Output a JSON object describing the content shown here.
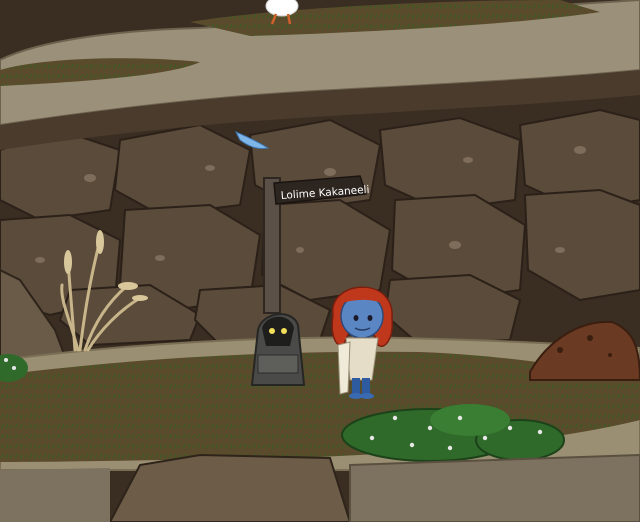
{
  "sign": {
    "label": "Lolime Kakaneeli"
  },
  "colors": {
    "cliff_dark": "#3a2d22",
    "rock": "#5a4a3b",
    "ledge": "#9a8f72",
    "ground_grass": "#4e4423",
    "bush": "#2f6a2a",
    "player_skin": "#5b86c4",
    "player_hair": "#c0381c"
  },
  "entities": {
    "player": "blue-skinned-red-haired-avatar",
    "npc": "hooded-robed-figure-glowing-eyes",
    "bird": "white-chicken",
    "flying": "small-blue-bird"
  }
}
